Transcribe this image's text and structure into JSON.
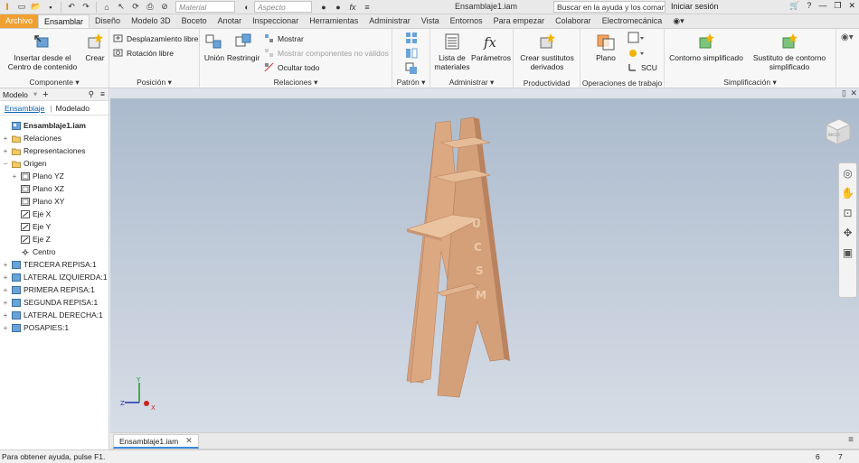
{
  "qat": {
    "material_placeholder": "Material",
    "appearance_placeholder": "Aspecto",
    "document_title": "Ensamblaje1.iam",
    "search_text": "Buscar en la ayuda y los comandos",
    "signin": "Iniciar sesión"
  },
  "tabs": [
    "Archivo",
    "Ensamblar",
    "Diseño",
    "Modelo 3D",
    "Boceto",
    "Anotar",
    "Inspeccionar",
    "Herramientas",
    "Administrar",
    "Vista",
    "Entornos",
    "Para empezar",
    "Colaborar",
    "Electromecánica"
  ],
  "ribbon": {
    "componente": {
      "title": "Componente",
      "insert_label": "Insertar desde el Centro de contenido",
      "create_label": "Crear"
    },
    "posicion": {
      "title": "Posición",
      "free_move": "Desplazamiento libre",
      "free_rotate": "Rotación libre"
    },
    "relaciones": {
      "title": "Relaciones",
      "join": "Unión",
      "constrain": "Restringir",
      "show": "Mostrar",
      "show_invalid": "Mostrar componentes no válidos",
      "hide_all": "Ocultar todo"
    },
    "patron": {
      "title": "Patrón"
    },
    "administrar": {
      "title": "Administrar",
      "bom": "Lista de materiales",
      "params": "Parámetros"
    },
    "productividad": {
      "title": "Productividad",
      "substitutes": "Crear sustitutos derivados"
    },
    "operaciones": {
      "title": "Operaciones de trabajo",
      "plane": "Plano",
      "ucs": "SCU"
    },
    "simplificacion": {
      "title": "Simplificación",
      "simplified": "Contorno simplificado",
      "substitute": "Sustituto de contorno simplificado"
    }
  },
  "browser": {
    "header": "Modelo",
    "tab_assembly": "Ensamblaje",
    "tab_modeling": "Modelado",
    "tree": [
      {
        "label": "Ensamblaje1.iam",
        "level": 0,
        "exp": "",
        "icon": "assembly-icon"
      },
      {
        "label": "Relaciones",
        "level": 1,
        "exp": "+",
        "icon": "folder-icon"
      },
      {
        "label": "Representaciones",
        "level": 1,
        "exp": "+",
        "icon": "folder-icon"
      },
      {
        "label": "Origen",
        "level": 1,
        "exp": "−",
        "icon": "folder-icon"
      },
      {
        "label": "Plano YZ",
        "level": 2,
        "exp": "+",
        "icon": "plane-icon"
      },
      {
        "label": "Plano XZ",
        "level": 2,
        "exp": "",
        "icon": "plane-icon"
      },
      {
        "label": "Plano XY",
        "level": 2,
        "exp": "",
        "icon": "plane-icon"
      },
      {
        "label": "Eje X",
        "level": 2,
        "exp": "",
        "icon": "axis-icon"
      },
      {
        "label": "Eje Y",
        "level": 2,
        "exp": "",
        "icon": "axis-icon"
      },
      {
        "label": "Eje Z",
        "level": 2,
        "exp": "",
        "icon": "axis-icon"
      },
      {
        "label": "Centro",
        "level": 2,
        "exp": "",
        "icon": "point-icon"
      },
      {
        "label": "TERCERA REPISA:1",
        "level": 1,
        "exp": "+",
        "icon": "part-icon"
      },
      {
        "label": "LATERAL IZQUIERDA:1",
        "level": 1,
        "exp": "+",
        "icon": "part-icon"
      },
      {
        "label": "PRIMERA REPISA:1",
        "level": 1,
        "exp": "+",
        "icon": "part-icon"
      },
      {
        "label": "SEGUNDA REPISA:1",
        "level": 1,
        "exp": "+",
        "icon": "part-icon"
      },
      {
        "label": "LATERAL DERECHA:1",
        "level": 1,
        "exp": "+",
        "icon": "part-icon"
      },
      {
        "label": "POSAPIES:1",
        "level": 1,
        "exp": "+",
        "icon": "part-icon"
      }
    ]
  },
  "viewport": {
    "engraving": "UCSM",
    "viewcube_label": "INICIO",
    "axis_x": "X",
    "axis_y": "Y",
    "axis_z": "Z"
  },
  "document_tab": "Ensamblaje1.iam",
  "status": {
    "message": "Para obtener ayuda, pulse F1.",
    "count_a": "6",
    "count_b": "7"
  },
  "colors": {
    "file_tab": "#f0a030",
    "wood": "#d9a57f",
    "wood_dark": "#c08560",
    "accent": "#0b62b8"
  }
}
